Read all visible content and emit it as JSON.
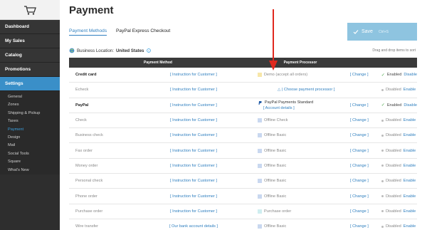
{
  "sidebar": {
    "nav": [
      "Dashboard",
      "My Sales",
      "Catalog",
      "Promotions",
      "Settings"
    ],
    "sub": [
      "General",
      "Zones",
      "Shipping & Pickup",
      "Taxes",
      "Payment",
      "Design",
      "Mail",
      "Social Tools",
      "Square",
      "What's New"
    ]
  },
  "page": {
    "title": "Payment",
    "tabs": [
      "Payment Methods",
      "PayPal Express Checkout"
    ],
    "save_label": "Save",
    "save_shortcut": "Ctrl+S",
    "location_label": "Business Location:",
    "location_value": "United States",
    "drag_hint": "Drag and drop items to sort"
  },
  "table": {
    "headers": [
      "Payment Method",
      "Payment Processor"
    ],
    "rows": [
      {
        "name": "Credit card",
        "bold": true,
        "instruction": "[ Instruction for Customer ]",
        "processor": "Demo (accept all orders)",
        "swatch": "#f7e6a8",
        "change": "[ Change ]",
        "status": "Enabled",
        "action": "Disable",
        "enabled": true
      },
      {
        "name": "Echeck",
        "bold": false,
        "instruction": "[ Instruction for Customer ]",
        "processor": "△ | Choose payment processor ]",
        "swatch": "",
        "change": "",
        "status": "Disabled",
        "action": "Enable",
        "enabled": false
      },
      {
        "name": "PayPal",
        "bold": true,
        "instruction": "[ Instruction for Customer ]",
        "processor": "PayPal Payments Standard",
        "processor2": "[ Account details ]",
        "swatch": "paypal",
        "change": "[ Change ]",
        "status": "Enabled",
        "action": "Disable",
        "enabled": true
      },
      {
        "name": "Check",
        "bold": false,
        "instruction": "[ Instruction for Customer ]",
        "processor": "Offline Check",
        "swatch": "#c9d8f0",
        "change": "[ Change ]",
        "status": "Disabled",
        "action": "Enable",
        "enabled": false
      },
      {
        "name": "Business check",
        "bold": false,
        "instruction": "[ Instruction for Customer ]",
        "processor": "Offline Basic",
        "swatch": "#c9d8f0",
        "change": "[ Change ]",
        "status": "Disabled",
        "action": "Enable",
        "enabled": false
      },
      {
        "name": "Fax order",
        "bold": false,
        "instruction": "[ Instruction for Customer ]",
        "processor": "Offline Basic",
        "swatch": "#c9d8f0",
        "change": "[ Change ]",
        "status": "Disabled",
        "action": "Enable",
        "enabled": false
      },
      {
        "name": "Money order",
        "bold": false,
        "instruction": "[ Instruction for Customer ]",
        "processor": "Offline Basic",
        "swatch": "#c9d8f0",
        "change": "[ Change ]",
        "status": "Disabled",
        "action": "Enable",
        "enabled": false
      },
      {
        "name": "Personal check",
        "bold": false,
        "instruction": "[ Instruction for Customer ]",
        "processor": "Offline Basic",
        "swatch": "#c9d8f0",
        "change": "[ Change ]",
        "status": "Disabled",
        "action": "Enable",
        "enabled": false
      },
      {
        "name": "Phone order",
        "bold": false,
        "instruction": "[ Instruction for Customer ]",
        "processor": "Offline Basic",
        "swatch": "#c9d8f0",
        "change": "[ Change ]",
        "status": "Disabled",
        "action": "Enable",
        "enabled": false
      },
      {
        "name": "Purchase order",
        "bold": false,
        "instruction": "[ Instruction for Customer ]",
        "processor": "Purchase order",
        "swatch": "#cfeef0",
        "change": "[ Change ]",
        "status": "Disabled",
        "action": "Enable",
        "enabled": false
      },
      {
        "name": "Wire transfer",
        "bold": false,
        "instruction": "[ Our bank account details ]",
        "processor": "Offline Basic",
        "swatch": "#c9d8f0",
        "change": "[ Change ]",
        "status": "Disabled",
        "action": "Enable",
        "enabled": false
      }
    ]
  },
  "colors": {
    "accent": "#3a8fc8",
    "annotation_arrow": "#e0281e"
  }
}
